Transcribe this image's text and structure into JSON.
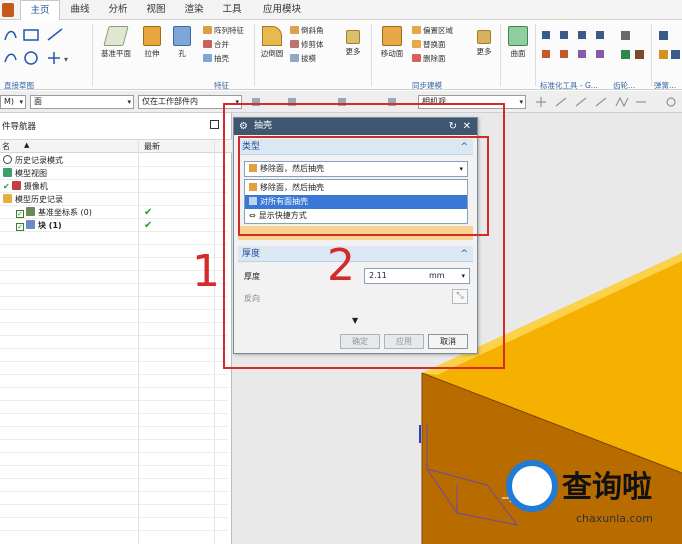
{
  "menu": {
    "items": [
      "主页",
      "曲线",
      "分析",
      "视图",
      "渲染",
      "工具",
      "应用模块"
    ],
    "active_index": 0
  },
  "ribbon": {
    "sketch_group_label": "直接草图",
    "datum_plane_label": "基准平面",
    "extrude_label": "拉伸",
    "hole_label": "孔",
    "feature_small": [
      "阵列特征",
      "合并",
      "抽壳"
    ],
    "feature_more_label": "更多",
    "feature_group_label": "特征",
    "edge_blend_label": "边倒圆",
    "edge_small": [
      "倒斜角",
      "修剪体",
      "拔模"
    ],
    "edge_more_label": "更多",
    "move_face_label": "移动面",
    "sync_small": [
      "偏置区域",
      "替换面",
      "删除面"
    ],
    "sync_more_label": "更多",
    "sync_group_label": "同步建模",
    "surface_label": "曲面",
    "std_group_label": "标准化工具 - G...",
    "gear_group_label": "齿轮...",
    "spring_group_label": "弹簧..."
  },
  "toolbar2": {
    "filter_value": "M)",
    "type_filter_value": "面",
    "scope_value": "仅在工作部件内",
    "snap_combo_value": "相机观"
  },
  "navigator": {
    "title": "件导航器",
    "col_name": "名",
    "col_latest": "最新",
    "nodes": [
      {
        "label": "历史记录模式"
      },
      {
        "label": "模型视图"
      },
      {
        "label": "摄像机"
      },
      {
        "label": "模型历史记录"
      },
      {
        "label": "基准坐标系 (0)"
      },
      {
        "label": "块 (1)"
      }
    ]
  },
  "dialog": {
    "title": "抽壳",
    "type_section": "类型",
    "type_value": "移除面，然后抽壳",
    "options": [
      "移除面，然后抽壳",
      "对所有面抽壳",
      "显示快捷方式"
    ],
    "selected_option_index": 1,
    "thickness_section": "厚度",
    "thickness_label": "厚度",
    "thickness_value": "2.11",
    "thickness_unit": "mm",
    "reverse_label": "反向",
    "ok_label": "确定",
    "apply_label": "应用",
    "cancel_label": "取消"
  },
  "annotations": {
    "label1": "1",
    "label2": "2",
    "outline_color": "#d42a2a"
  },
  "watermark": {
    "brand_cn": "查询啦",
    "domain": "chaxunla.com"
  },
  "colors": {
    "titlebar": "#3e5670",
    "selection": "#3a78d6",
    "solid_top": "#f5b000",
    "solid_front": "#b86c00"
  }
}
